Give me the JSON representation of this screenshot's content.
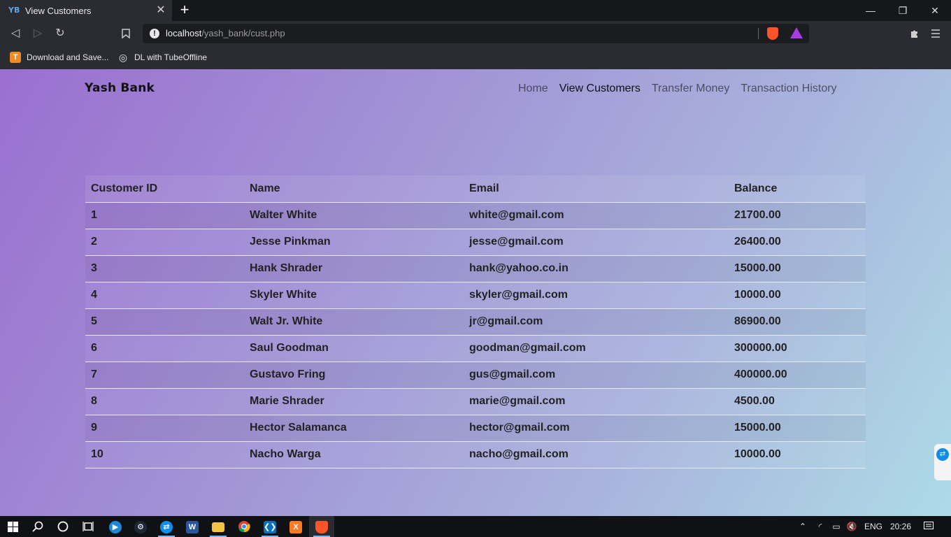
{
  "browser": {
    "tab": {
      "favicon_text": "YB",
      "title": "View Customers",
      "close_glyph": "✕"
    },
    "new_tab_glyph": "+",
    "window": {
      "minimize": "—",
      "restore": "❐",
      "close": "✕"
    },
    "nav": {
      "back": "◁",
      "forward": "▷",
      "reload": "↻",
      "bookmark": "🔖"
    },
    "url": {
      "host": "localhost",
      "path": "/yash_bank/cust.php"
    },
    "icons": {
      "site_info": "info-icon",
      "brave": "brave-lion-icon",
      "rewards": "brave-rewards-icon",
      "extensions": "puzzle-icon",
      "menu": "hamburger-icon"
    },
    "bookmarks": [
      {
        "label": "Download and Save...",
        "icon_text": "T",
        "color": "#f08a24"
      },
      {
        "label": "DL with TubeOffline",
        "icon_text": "◎",
        "color": "#e8e8e8"
      }
    ]
  },
  "site": {
    "brand": "Yash Bank",
    "nav": [
      {
        "label": "Home"
      },
      {
        "label": "View Customers"
      },
      {
        "label": "Transfer Money"
      },
      {
        "label": "Transaction History"
      }
    ]
  },
  "table": {
    "headers": {
      "id": "Customer ID",
      "name": "Name",
      "email": "Email",
      "balance": "Balance"
    },
    "rows": [
      {
        "id": "1",
        "name": "Walter White",
        "email": "white@gmail.com",
        "balance": "21700.00"
      },
      {
        "id": "2",
        "name": "Jesse Pinkman",
        "email": "jesse@gmail.com",
        "balance": "26400.00"
      },
      {
        "id": "3",
        "name": "Hank Shrader",
        "email": "hank@yahoo.co.in",
        "balance": "15000.00"
      },
      {
        "id": "4",
        "name": "Skyler White",
        "email": "skyler@gmail.com",
        "balance": "10000.00"
      },
      {
        "id": "5",
        "name": "Walt Jr. White",
        "email": "jr@gmail.com",
        "balance": "86900.00"
      },
      {
        "id": "6",
        "name": "Saul Goodman",
        "email": "goodman@gmail.com",
        "balance": "300000.00"
      },
      {
        "id": "7",
        "name": "Gustavo Fring",
        "email": "gus@gmail.com",
        "balance": "400000.00"
      },
      {
        "id": "8",
        "name": "Marie Shrader",
        "email": "marie@gmail.com",
        "balance": "4500.00"
      },
      {
        "id": "9",
        "name": "Hector Salamanca",
        "email": "hector@gmail.com",
        "balance": "15000.00"
      },
      {
        "id": "10",
        "name": "Nacho Warga",
        "email": "nacho@gmail.com",
        "balance": "10000.00"
      }
    ]
  },
  "taskbar": {
    "apps": [
      "windows-start-icon",
      "search-icon",
      "cortana-icon",
      "task-view-icon",
      "media-player-icon",
      "steam-icon",
      "teamviewer-icon",
      "word-icon",
      "file-explorer-icon",
      "chrome-icon",
      "vscode-icon",
      "xampp-icon",
      "brave-icon"
    ],
    "language": "ENG",
    "time": "20:26"
  },
  "colors": {
    "page_gradient_start": "#9b6fd0",
    "page_gradient_end": "#addbe6",
    "chrome_dark": "#2b2c31",
    "taskbar": "#101114",
    "brave_orange": "#fb542b"
  }
}
